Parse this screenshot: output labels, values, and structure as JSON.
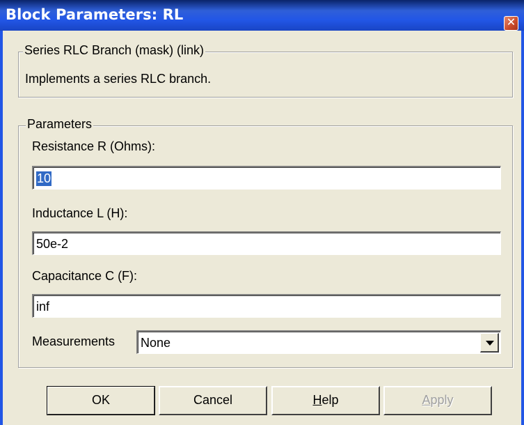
{
  "window": {
    "title": "Block Parameters: RL",
    "close_glyph": "✕"
  },
  "description_group": {
    "legend": "Series RLC Branch (mask) (link)",
    "text": "Implements a series RLC branch."
  },
  "parameters_group": {
    "legend": "Parameters",
    "resistance": {
      "label": "Resistance R (Ohms):",
      "value": "10"
    },
    "inductance": {
      "label": "Inductance L (H):",
      "value": "50e-2"
    },
    "capacitance": {
      "label": "Capacitance C (F):",
      "value": "inf"
    },
    "measurements": {
      "label": "Measurements",
      "selected": "None"
    }
  },
  "buttons": {
    "ok": "OK",
    "cancel": "Cancel",
    "help_underlined": "H",
    "help_rest": "elp",
    "apply_underlined": "A",
    "apply_rest": "pply"
  },
  "colors": {
    "titlebar": "#2256E6",
    "dialog_bg": "#ECE9D8",
    "selection": "#316AC5",
    "close_button": "#C94A2A"
  }
}
